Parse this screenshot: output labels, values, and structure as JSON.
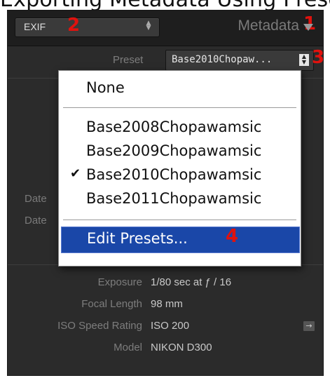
{
  "caption": "Exporting Metadata Using Presets",
  "header": {
    "select_value": "EXIF",
    "title": "Metadata"
  },
  "markers": [
    "1",
    "2",
    "3",
    "4"
  ],
  "preset": {
    "label": "Preset",
    "value": "Base2010Chopaw..."
  },
  "menu": {
    "none": "None",
    "items": [
      "Base2008Chopawamsic",
      "Base2009Chopawamsic",
      "Base2010Chopawamsic",
      "Base2011Chopawamsic"
    ],
    "checked_index": 2,
    "check_mark": "✔",
    "edit_label": "Edit Presets..."
  },
  "obscured_labels": [
    "Date",
    "Date"
  ],
  "fields": [
    {
      "label": "Exposure",
      "value": "1/80 sec at ƒ / 16"
    },
    {
      "label": "Focal Length",
      "value": "98 mm"
    },
    {
      "label": "ISO Speed Rating",
      "value": "ISO 200"
    },
    {
      "label": "Model",
      "value": "NIKON D300"
    }
  ],
  "colors": {
    "panel_bg": "#2b2b2b",
    "highlight": "#1a47a8",
    "marker_red": "#e0120e"
  }
}
